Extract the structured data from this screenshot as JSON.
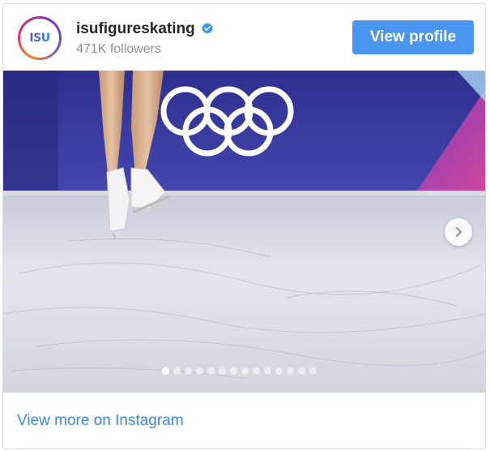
{
  "profile": {
    "avatar_text": "ISU",
    "username": "isufigureskating",
    "verified_icon": "verified-badge-icon",
    "followers": "471K followers",
    "view_profile_label": "View profile"
  },
  "carousel": {
    "slide_count": 14,
    "active_index": 0,
    "next_icon": "chevron-right-icon"
  },
  "footer": {
    "view_more_label": "View more on Instagram"
  },
  "colors": {
    "button": "#4a95f0",
    "link": "#3e86e8",
    "verified": "#3897f0",
    "arena_wall": "#3a3fa0"
  }
}
